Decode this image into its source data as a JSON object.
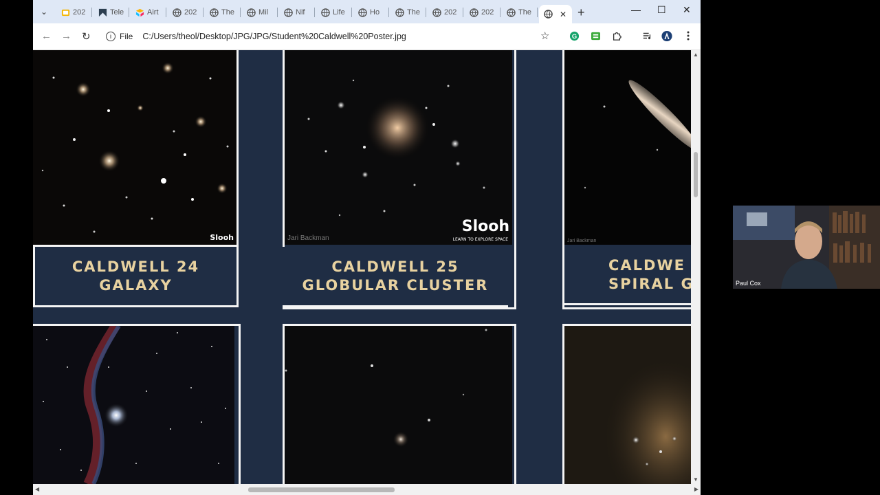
{
  "browser": {
    "tabs": [
      {
        "label": "202",
        "icon": "slides-icon"
      },
      {
        "label": "Tele",
        "icon": "telescope-icon"
      },
      {
        "label": "Airt",
        "icon": "airtable-icon"
      },
      {
        "label": "202",
        "icon": "globe-icon"
      },
      {
        "label": "The",
        "icon": "globe-icon"
      },
      {
        "label": "Mil",
        "icon": "globe-icon"
      },
      {
        "label": "Nif",
        "icon": "globe-icon"
      },
      {
        "label": "Life",
        "icon": "globe-icon"
      },
      {
        "label": "Ho",
        "icon": "globe-icon"
      },
      {
        "label": "The",
        "icon": "globe-icon"
      },
      {
        "label": "202",
        "icon": "globe-icon"
      },
      {
        "label": "202",
        "icon": "globe-icon"
      },
      {
        "label": "The",
        "icon": "globe-icon"
      }
    ],
    "active_tab_icon": "globe-icon",
    "site_chip": "File",
    "url": "C:/Users/theol/Desktop/JPG/JPG/Student%20Caldwell%20Poster.jpg"
  },
  "poster": {
    "cards": [
      {
        "line1": "CALDWELL 24",
        "line2": "GALAXY"
      },
      {
        "line1": "CALDWELL 25",
        "line2": "GLOBULAR CLUSTER"
      },
      {
        "line1": "CALDWE",
        "line2": "SPIRAL G"
      }
    ],
    "watermark_brand": "Slooh",
    "watermark_tagline": "LEARN TO EXPLORE SPACE",
    "photo_credit": "Jari Backman",
    "colors": {
      "panel": "#1f2d44",
      "title_text": "#e8d2a0",
      "frame": "#f5f5f5"
    }
  },
  "webcam": {
    "name": "Paul Cox"
  }
}
